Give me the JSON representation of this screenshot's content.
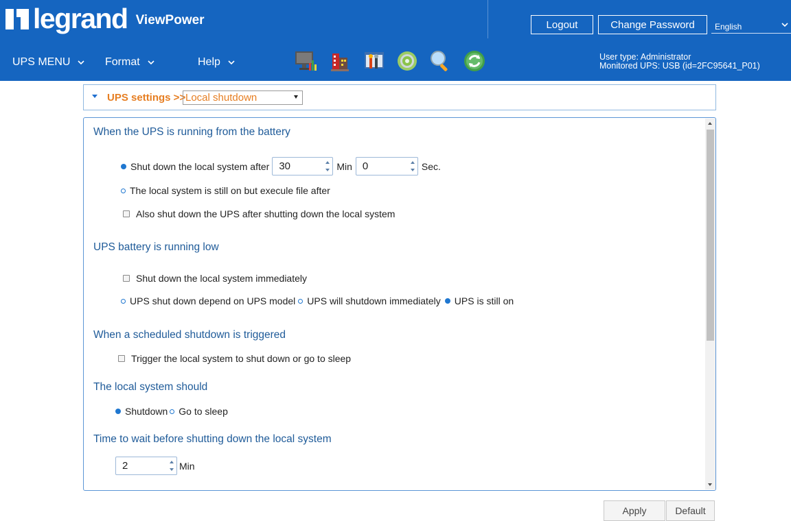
{
  "brand": {
    "logo_text": "legrand",
    "product": "ViewPower"
  },
  "header": {
    "logout_label": "Logout",
    "change_password_label": "Change Password",
    "language_value": "English",
    "user_type": "User type: Administrator",
    "monitored_ups": "Monitored UPS: USB (id=2FC95641_P01)"
  },
  "menu": [
    {
      "label": "UPS MENU"
    },
    {
      "label": "Format"
    },
    {
      "label": "Help"
    }
  ],
  "toolbar_icons": [
    "monitor-icon",
    "building-icon",
    "tools-icon",
    "gear-icon",
    "search-icon",
    "refresh-icon"
  ],
  "breadcrumb": {
    "section": "UPS settings >>",
    "selected": "Local shutdown"
  },
  "battery_section": {
    "title": "When the UPS is running from the battery",
    "opt_shutdown_after": "Shut down the local system after",
    "minutes_value": "30",
    "min_unit": "Min",
    "seconds_value": "0",
    "sec_unit": "Sec.",
    "opt_execute_file": "The local system is still on but execule file after",
    "also_shutdown_ups": "Also shut down the UPS after shutting down the local system"
  },
  "low_battery_section": {
    "title": "UPS battery is running low",
    "shutdown_immediately": "Shut down the local system immediately",
    "opt_depend_model": "UPS shut down depend on UPS model",
    "opt_ups_immediate": "UPS will shutdown immediately",
    "opt_ups_still_on": "UPS is still on"
  },
  "scheduled_section": {
    "title": "When a scheduled shutdown is triggered",
    "trigger_label": "Trigger the local system to shut down or go to sleep"
  },
  "local_system_section": {
    "title": "The local system should",
    "opt_shutdown": "Shutdown",
    "opt_sleep": "Go to sleep"
  },
  "wait_section": {
    "title": "Time to wait before shutting down the local system",
    "value": "2",
    "unit": "Min"
  },
  "actions": {
    "apply_label": "Apply",
    "default_label": "Default"
  }
}
